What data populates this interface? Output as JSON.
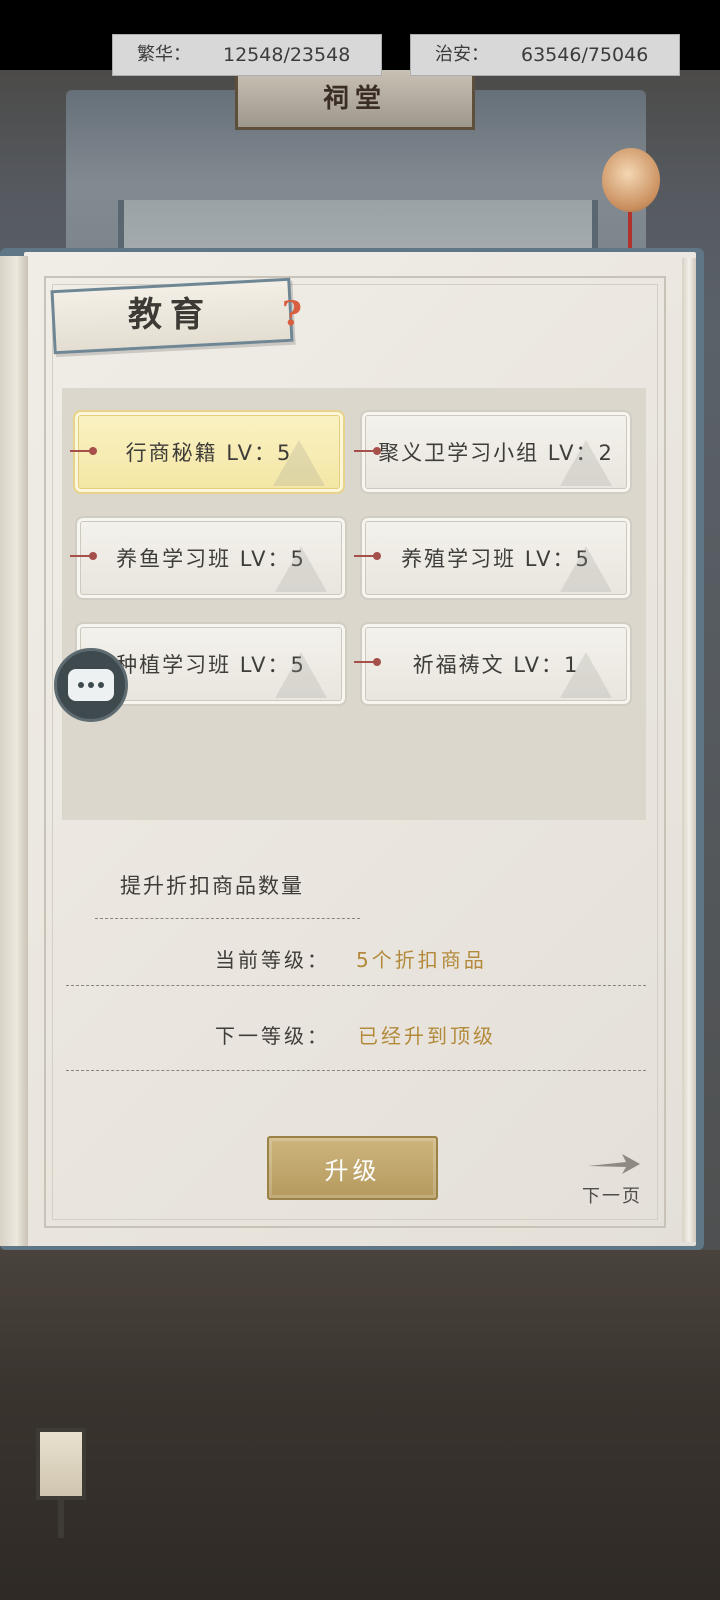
{
  "scene": {
    "shrine_sign": "祠堂"
  },
  "stats": {
    "prosperity_label": "繁华：",
    "prosperity_value": "12548/23548",
    "security_label": "治安：",
    "security_value": "63546/75046"
  },
  "panel": {
    "title": "教育",
    "help_icon": "?"
  },
  "skills": [
    {
      "label": "行商秘籍 LV：5",
      "selected": true
    },
    {
      "label": "聚义卫学习小组 LV：2",
      "selected": false
    },
    {
      "label": "养鱼学习班 LV：5",
      "selected": false
    },
    {
      "label": "养殖学习班 LV：5",
      "selected": false
    },
    {
      "label": "种植学习班 LV：5",
      "selected": false
    },
    {
      "label": "祈福祷文 LV：1",
      "selected": false
    }
  ],
  "effect": {
    "title": "提升折扣商品数量",
    "current_label": "当前等级：",
    "current_value": "5个折扣商品",
    "next_label": "下一等级：",
    "next_value": "已经升到顶级"
  },
  "actions": {
    "upgrade_label": "升级",
    "next_page_label": "下一页"
  },
  "icons": {
    "chat": "chat-bubble-icon",
    "help": "help-icon",
    "next": "arrow-right-icon"
  },
  "colors": {
    "accent_gold": "#b38a3c",
    "selected_card": "#f3e6a4",
    "connector_red": "#a5504b"
  }
}
